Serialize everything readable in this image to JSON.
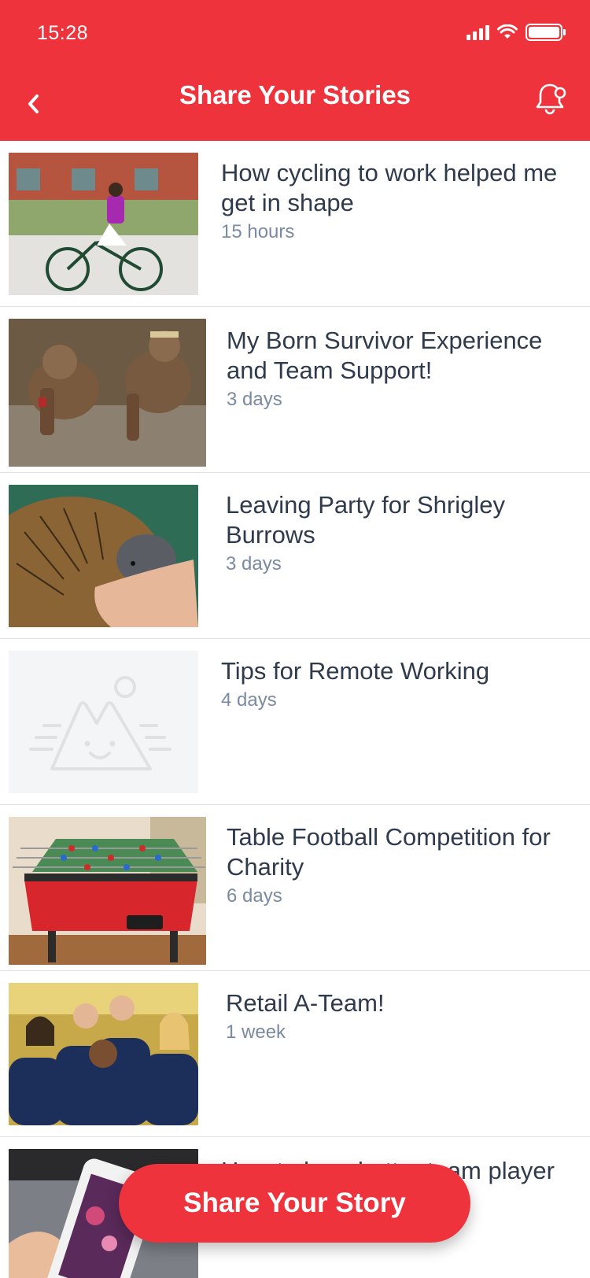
{
  "status_bar": {
    "time": "15:28"
  },
  "header": {
    "title": "Share Your Stories"
  },
  "stories": [
    {
      "title": "How cycling to work helped me get in shape",
      "time": "15 hours",
      "image": "cyclist-photo"
    },
    {
      "title": "My Born Survivor Experience and Team Support!",
      "time": "3 days",
      "image": "mud-run-photo"
    },
    {
      "title": "Leaving Party for Shrigley Burrows",
      "time": "3 days",
      "image": "hedgehog-photo"
    },
    {
      "title": "Tips for Remote Working",
      "time": "4 days",
      "image": "placeholder-image"
    },
    {
      "title": "Table Football Competition for Charity",
      "time": "6 days",
      "image": "table-football-photo"
    },
    {
      "title": "Retail A-Team!",
      "time": "1 week",
      "image": "team-photo"
    },
    {
      "title": "How to be a better team player",
      "time": "",
      "image": "phone-photo"
    }
  ],
  "share_button": {
    "label": "Share Your Story"
  },
  "colors": {
    "brand": "#ee333c",
    "title_text": "#2f3b4c",
    "meta_text": "#7a8aa2"
  }
}
